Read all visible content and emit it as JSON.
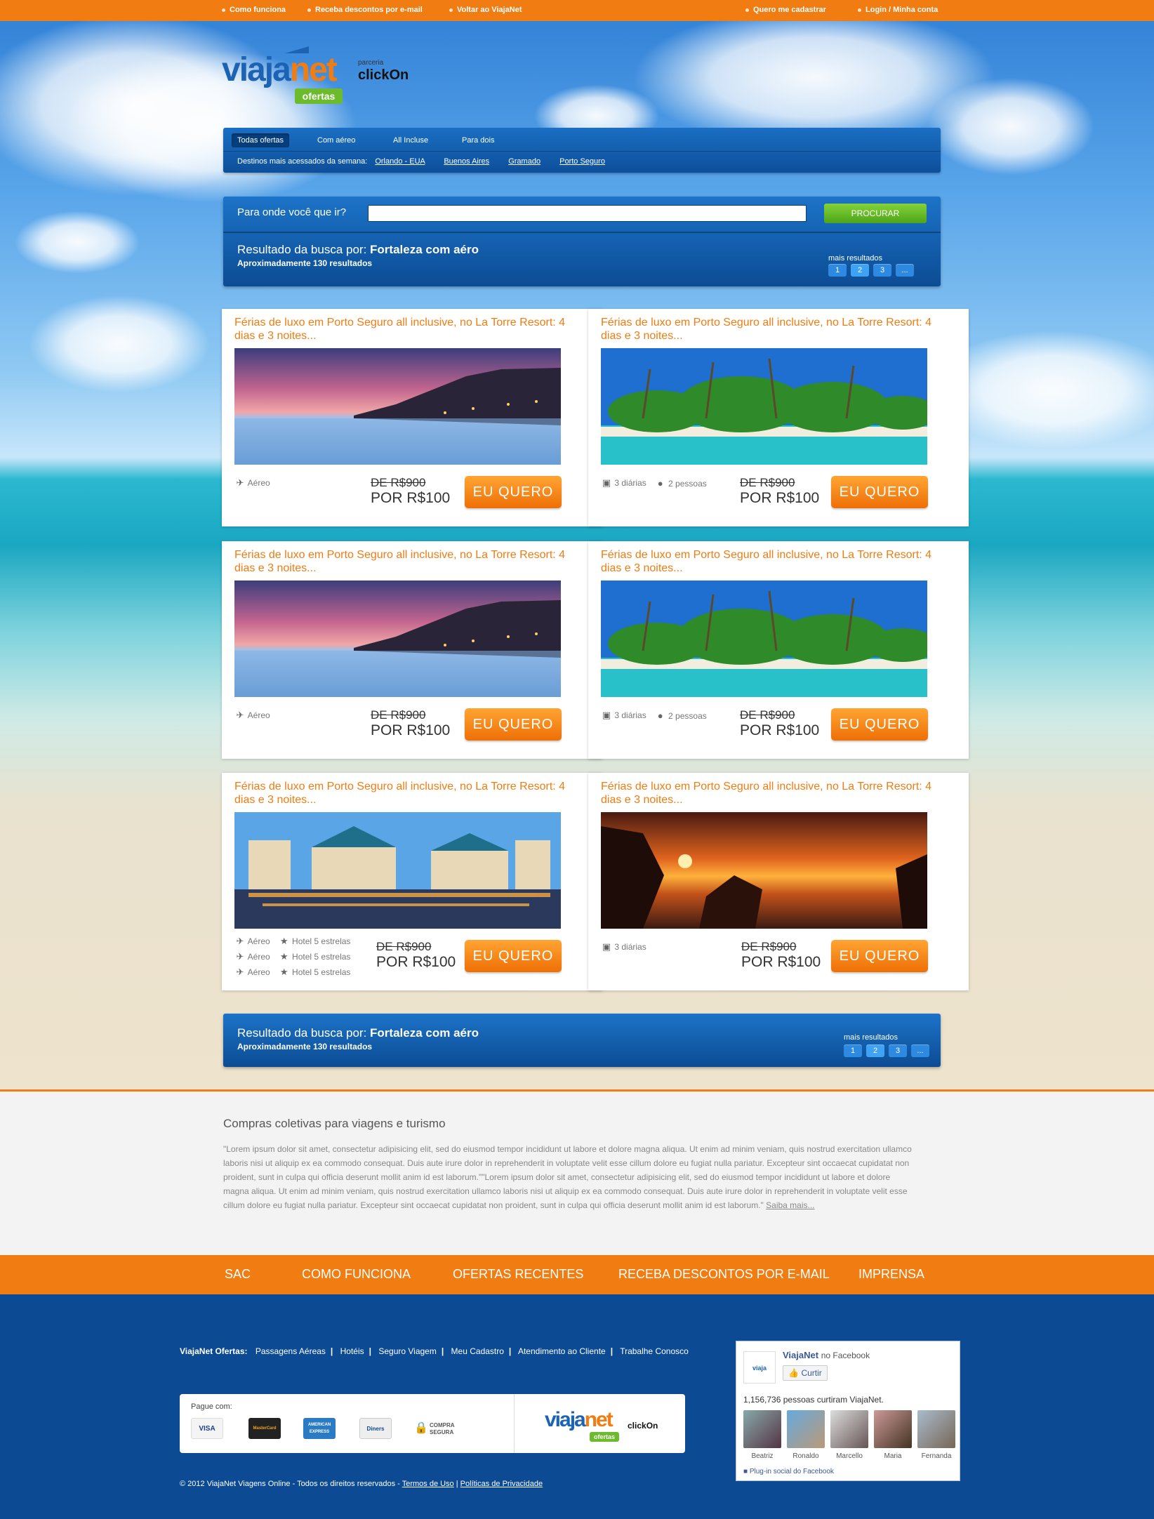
{
  "topbar": {
    "left": [
      "Como funciona",
      "Receba descontos por e-mail",
      "Voltar ao ViajaNet"
    ],
    "right": [
      "Quero me cadastrar",
      "Login / Minha conta"
    ]
  },
  "logo": {
    "brand_a": "viaja",
    "brand_b": "net",
    "badge": "ofertas",
    "partner_label": "parceria",
    "partner": "clickOn"
  },
  "nav": {
    "tabs": [
      "Todas ofertas",
      "Com aéreo",
      "All Incluse",
      "Para dois"
    ],
    "dest_label": "Destinos mais acessados da semana:",
    "destinations": [
      "Orlando - EUA",
      "Buenos Aires",
      "Gramado",
      "Porto Seguro"
    ]
  },
  "search": {
    "label": "Para onde você que ir?",
    "input_value": "",
    "button": "PROCURAR"
  },
  "results": {
    "prefix": "Resultado da busca por:",
    "query": "Fortaleza com aéro",
    "count": "Aproximadamente 130 resultados",
    "more": "mais resultados",
    "pages": [
      "1",
      "2",
      "3",
      "..."
    ]
  },
  "cards": [
    {
      "title": "Férias de luxo em Porto Seguro all inclusive, no La Torre Resort: 4 dias e 3 noites...",
      "photo": "sunset-coast",
      "meta": [
        [
          "plane-icon",
          "Aéreo"
        ]
      ],
      "old": "DE R$900",
      "new": "POR R$100",
      "cta": "EU QUERO"
    },
    {
      "title": "Férias de luxo em Porto Seguro all inclusive, no La Torre Resort: 4 dias e 3 noites...",
      "photo": "palm-island",
      "meta": [
        [
          "calendar-icon",
          "3 diárias"
        ],
        [
          "person-icon",
          "2 pessoas"
        ]
      ],
      "old": "DE R$900",
      "new": "POR R$100",
      "cta": "EU QUERO"
    },
    {
      "title": "Férias de luxo em Porto Seguro all inclusive, no La Torre Resort: 4 dias e 3 noites...",
      "photo": "sunset-coast",
      "meta": [
        [
          "plane-icon",
          "Aéreo"
        ]
      ],
      "old": "DE R$900",
      "new": "POR R$100",
      "cta": "EU QUERO"
    },
    {
      "title": "Férias de luxo em Porto Seguro all inclusive, no La Torre Resort: 4 dias e 3 noites...",
      "photo": "palm-island",
      "meta": [
        [
          "calendar-icon",
          "3 diárias"
        ],
        [
          "person-icon",
          "2 pessoas"
        ]
      ],
      "old": "DE R$900",
      "new": "POR R$100",
      "cta": "EU QUERO"
    },
    {
      "title": "Férias de luxo em Porto Seguro all inclusive, no La Torre Resort: 4 dias e 3 noites...",
      "photo": "resort-lake",
      "meta": [
        [
          "plane-icon",
          "Aéreo",
          "star-icon",
          "Hotel 5 estrelas"
        ],
        [
          "plane-icon",
          "Aéreo",
          "star-icon",
          "Hotel 5 estrelas"
        ],
        [
          "plane-icon",
          "Aéreo",
          "star-icon",
          "Hotel 5 estrelas"
        ]
      ],
      "old": "DE R$900",
      "new": "POR R$100",
      "cta": "EU QUERO"
    },
    {
      "title": "Férias de luxo em Porto Seguro all inclusive, no La Torre Resort: 4 dias e 3 noites...",
      "photo": "orange-sunset",
      "meta": [
        [
          "calendar-icon",
          "3 diárias"
        ]
      ],
      "old": "DE R$900",
      "new": "POR R$100",
      "cta": "EU QUERO"
    }
  ],
  "about": {
    "title": "Compras coletivas para viagens e turismo",
    "text": "\"Lorem ipsum dolor sit amet, consectetur adipisicing elit, sed do eiusmod tempor incididunt ut labore et dolore magna aliqua. Ut enim ad minim veniam, quis nostrud exercitation ullamco laboris nisi ut aliquip ex ea commodo consequat. Duis aute irure dolor in reprehenderit in voluptate velit esse cillum dolore eu fugiat nulla pariatur. Excepteur sint occaecat cupidatat non proident, sunt in culpa qui officia deserunt mollit anim id est laborum.\"\"Lorem ipsum dolor sit amet, consectetur adipisicing elit, sed do eiusmod tempor incididunt ut labore et dolore magna aliqua. Ut enim ad minim veniam, quis nostrud exercitation ullamco laboris nisi ut aliquip ex ea commodo consequat. Duis aute irure dolor in reprehenderit in voluptate velit esse cillum dolore eu fugiat nulla pariatur. Excepteur sint occaecat cupidatat non proident, sunt in culpa qui officia deserunt mollit anim id est laborum.\"",
    "more": "Saiba mais..."
  },
  "orange_nav": [
    "SAC",
    "COMO FUNCIONA",
    "OFERTAS RECENTES",
    "RECEBA DESCONTOS POR E-MAIL",
    "IMPRENSA"
  ],
  "footer": {
    "links_label": "ViajaNet Ofertas:",
    "links": [
      "Passagens Aéreas",
      "Hotéis",
      "Seguro Viagem",
      "Meu Cadastro",
      "Atendimento ao Cliente",
      "Trabalhe Conosco"
    ],
    "pay_label": "Pague com:",
    "cards": [
      "VISA",
      "MasterCard",
      "AMERICAN EXPRESS",
      "Diners"
    ],
    "secure": "COMPRA SEGURA",
    "copyright": "© 2012 ViajaNet Viagens Online - Todos os direitos reservados -",
    "terms": "Termos de Uso",
    "privacy": "Políticas de Privacidade"
  },
  "facebook": {
    "page": "ViajaNet",
    "suffix": "no Facebook",
    "like": "Curtir",
    "count": "1,156,736 pessoas curtiram ViajaNet.",
    "fans": [
      "Beatriz",
      "Ronaldo",
      "Marcello",
      "Maria",
      "Fernanda"
    ],
    "plugin": "Plug-in social do Facebook"
  },
  "colors": {
    "orange": "#f07c12",
    "blue": "#0c4a93",
    "green": "#6cbb2c"
  }
}
